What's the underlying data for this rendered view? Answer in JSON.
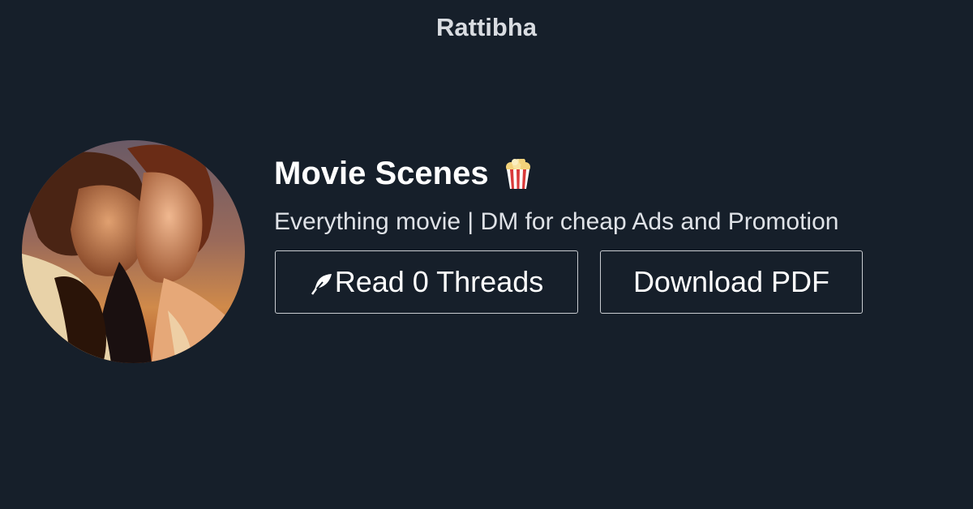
{
  "header": {
    "brand": "Rattibha"
  },
  "profile": {
    "avatar_icon": "avatar",
    "name": "Movie Scenes",
    "name_icon": "popcorn-icon",
    "bio": "Everything movie | DM for cheap Ads and Promotion"
  },
  "actions": {
    "read_label": "Read 0 Threads",
    "read_icon": "feather-icon",
    "download_label": "Download PDF"
  },
  "colors": {
    "background": "#161f2a",
    "text": "#ffffff",
    "button_border": "#c9ccd1"
  }
}
